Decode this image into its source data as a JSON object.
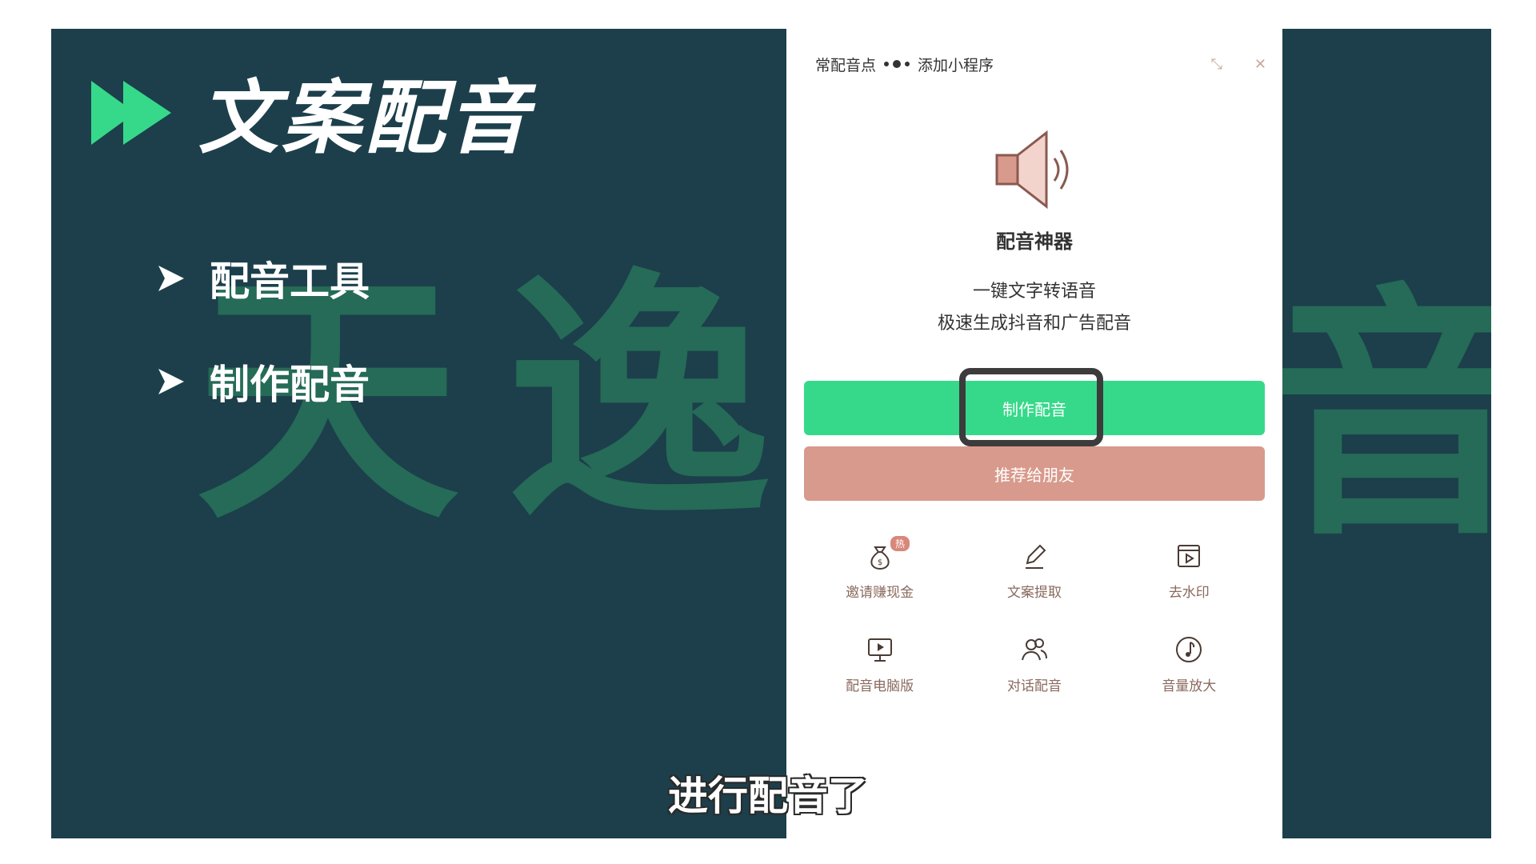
{
  "slide": {
    "title": "文案配音",
    "bullets": [
      "配音工具",
      "制作配音"
    ],
    "watermark_chars": [
      "天",
      "逸",
      "音"
    ],
    "colors": {
      "background": "#1c3f4b",
      "accent": "#36d98a",
      "watermark": "#2e8f62"
    }
  },
  "phone": {
    "top_bar": {
      "left_text": "常配音点",
      "right_text": "添加小程序"
    },
    "app_name": "配音神器",
    "slogan_line1": "一键文字转语音",
    "slogan_line2": "极速生成抖音和广告配音",
    "primary_button": "制作配音",
    "secondary_button": "推荐给朋友",
    "features": [
      {
        "label": "邀请赚现金",
        "icon": "money-bag-icon",
        "badge": "热"
      },
      {
        "label": "文案提取",
        "icon": "pen-icon"
      },
      {
        "label": "去水印",
        "icon": "video-icon"
      },
      {
        "label": "配音电脑版",
        "icon": "monitor-play-icon"
      },
      {
        "label": "对话配音",
        "icon": "users-icon"
      },
      {
        "label": "音量放大",
        "icon": "music-note-icon"
      }
    ],
    "colors": {
      "primary": "#36d98a",
      "secondary": "#d89a8c",
      "label": "#8a6a5e"
    }
  },
  "subtitle": "进行配音了"
}
